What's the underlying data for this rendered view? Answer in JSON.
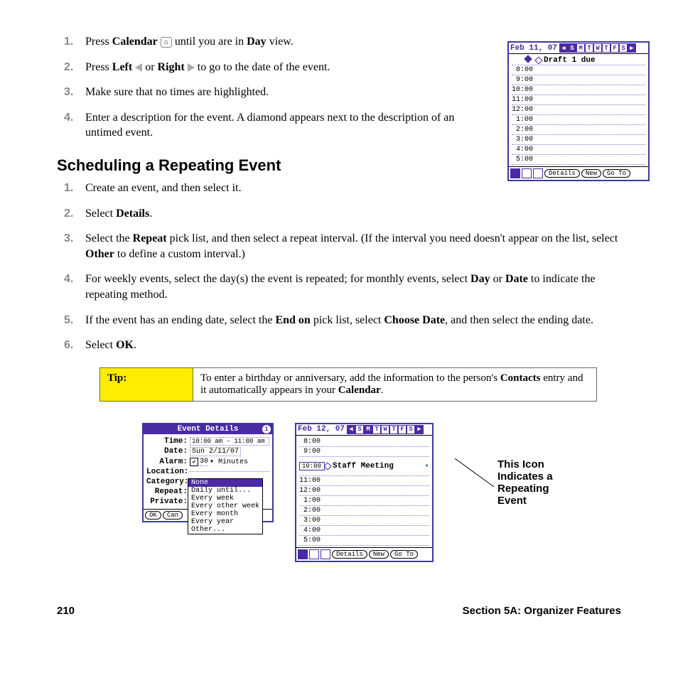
{
  "list1": {
    "step1_a": "Press ",
    "step1_b": "Calendar",
    "step1_c": " until you are in ",
    "step1_d": "Day",
    "step1_e": " view.",
    "step2_a": "Press ",
    "step2_b": "Left",
    "step2_c": " or ",
    "step2_d": "Right",
    "step2_e": " to go to the date of the event.",
    "step3": "Make sure that no times are highlighted.",
    "step4": "Enter a description for the event. A diamond appears next to the description of an untimed event."
  },
  "heading": "Scheduling a Repeating Event",
  "list2": {
    "s1": "Create an event, and then select it.",
    "s2_a": "Select ",
    "s2_b": "Details",
    "s2_c": ".",
    "s3_a": "Select the ",
    "s3_b": "Repeat",
    "s3_c": " pick list, and then select a repeat interval. (If the interval you need doesn't appear on the list, select ",
    "s3_d": "Other",
    "s3_e": " to define a custom interval.)",
    "s4_a": "For weekly events, select the day(s) the event is repeated; for monthly events, select ",
    "s4_b": "Day",
    "s4_c": " or ",
    "s4_d": "Date",
    "s4_e": " to indicate the repeating method.",
    "s5_a": "If the event has an ending date, select the ",
    "s5_b": "End on",
    "s5_c": " pick list, select ",
    "s5_d": "Choose Date",
    "s5_e": ", and then select the ending date.",
    "s6_a": "Select ",
    "s6_b": "OK",
    "s6_c": "."
  },
  "tip": {
    "label": "Tip:",
    "text_a": "To enter a birthday or anniversary, add the information to the person's ",
    "text_b": "Contacts",
    "text_c": " entry and it automatically appears in your ",
    "text_d": "Calendar",
    "text_e": "."
  },
  "palm_day1": {
    "date": "Feb 11, 07",
    "days": [
      "S",
      "M",
      "T",
      "W",
      "T",
      "F",
      "S"
    ],
    "untimed_event": "Draft 1 due",
    "times": [
      "8:00",
      "9:00",
      "10:00",
      "11:00",
      "12:00",
      "1:00",
      "2:00",
      "3:00",
      "4:00",
      "5:00"
    ],
    "btn_details": "Details",
    "btn_new": "New",
    "btn_goto": "Go To"
  },
  "palm_details": {
    "title": "Event Details",
    "time_lbl": "Time:",
    "time_val": "10:00 am - 11:00 am",
    "date_lbl": "Date:",
    "date_val": "Sun 2/11/07",
    "alarm_lbl": "Alarm:",
    "alarm_val": "30",
    "alarm_unit": "Minutes",
    "loc_lbl": "Location:",
    "cat_lbl": "Category:",
    "rep_lbl": "Repeat:",
    "priv_lbl": "Private:",
    "ok": "OK",
    "cancel": "Can",
    "options": [
      "None",
      "Daily until...",
      "Every week",
      "Every other week",
      "Every month",
      "Every year",
      "Other..."
    ]
  },
  "palm_day2": {
    "date": "Feb 12, 07",
    "days": [
      "S",
      "M",
      "T",
      "W",
      "T",
      "F",
      "S"
    ],
    "event_time": "10:00",
    "event_name": "Staff Meeting",
    "times": [
      "8:00",
      "9:00",
      "11:00",
      "12:00",
      "1:00",
      "2:00",
      "3:00",
      "4:00",
      "5:00"
    ],
    "btn_details": "Details",
    "btn_new": "New",
    "btn_goto": "Go To"
  },
  "caption": "This Icon Indicates a Repeating Event",
  "footer": {
    "page": "210",
    "section": "Section 5A: Organizer Features"
  }
}
